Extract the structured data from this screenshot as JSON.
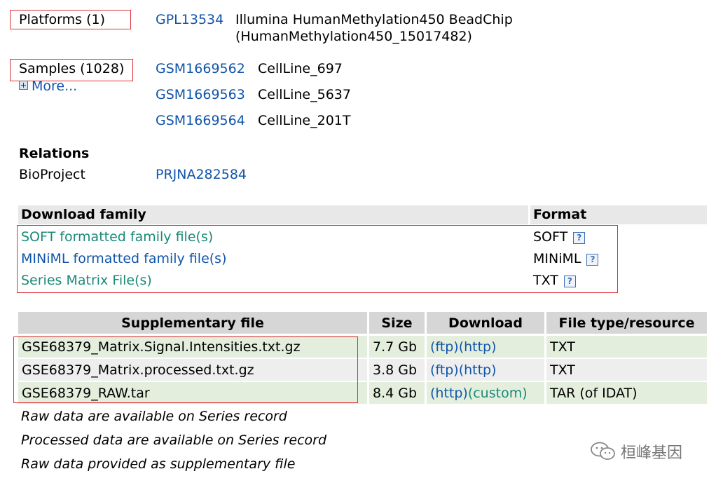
{
  "platforms": {
    "label": "Platforms (1)",
    "items": [
      {
        "id": "GPL13534",
        "desc_line1": "Illumina HumanMethylation450 BeadChip",
        "desc_line2": "(HumanMethylation450_15017482)"
      }
    ]
  },
  "samples": {
    "label": "Samples (1028)",
    "more_label": "More...",
    "items": [
      {
        "id": "GSM1669562",
        "name": "CellLine_697"
      },
      {
        "id": "GSM1669563",
        "name": "CellLine_5637"
      },
      {
        "id": "GSM1669564",
        "name": "CellLine_201T"
      }
    ]
  },
  "relations": {
    "title": "Relations",
    "label": "BioProject",
    "value": "PRJNA282584"
  },
  "download_family": {
    "col_header": "Download family",
    "format_header": "Format",
    "rows": [
      {
        "label": "SOFT formatted family file(s)",
        "format": "SOFT"
      },
      {
        "label": "MINiML formatted family file(s)",
        "format": "MINiML"
      },
      {
        "label": "Series Matrix File(s)",
        "format": "TXT"
      }
    ],
    "help_glyph": "?"
  },
  "supplementary": {
    "headers": [
      "Supplementary file",
      "Size",
      "Download",
      "File type/resource"
    ],
    "rows": [
      {
        "file": "GSE68379_Matrix.Signal.Intensities.txt.gz",
        "size": "7.7 Gb",
        "link1": "(ftp)",
        "link2": "(http)",
        "type": "TXT"
      },
      {
        "file": "GSE68379_Matrix.processed.txt.gz",
        "size": "3.8 Gb",
        "link1": "(ftp)",
        "link2": "(http)",
        "type": "TXT"
      },
      {
        "file": "GSE68379_RAW.tar",
        "size": "8.4 Gb",
        "link1": "(http)",
        "link2": "(custom)",
        "type": "TAR (of IDAT)"
      }
    ],
    "notes": [
      "Raw data are available on Series record",
      "Processed data are available on Series record",
      "Raw data provided as supplementary file"
    ]
  },
  "watermark": {
    "text": "桓峰基因"
  },
  "colors": {
    "link": "#1155aa",
    "link_teal": "#1a8a78",
    "highlight_box": "#e0303a",
    "row_green": "#e3eedd"
  }
}
